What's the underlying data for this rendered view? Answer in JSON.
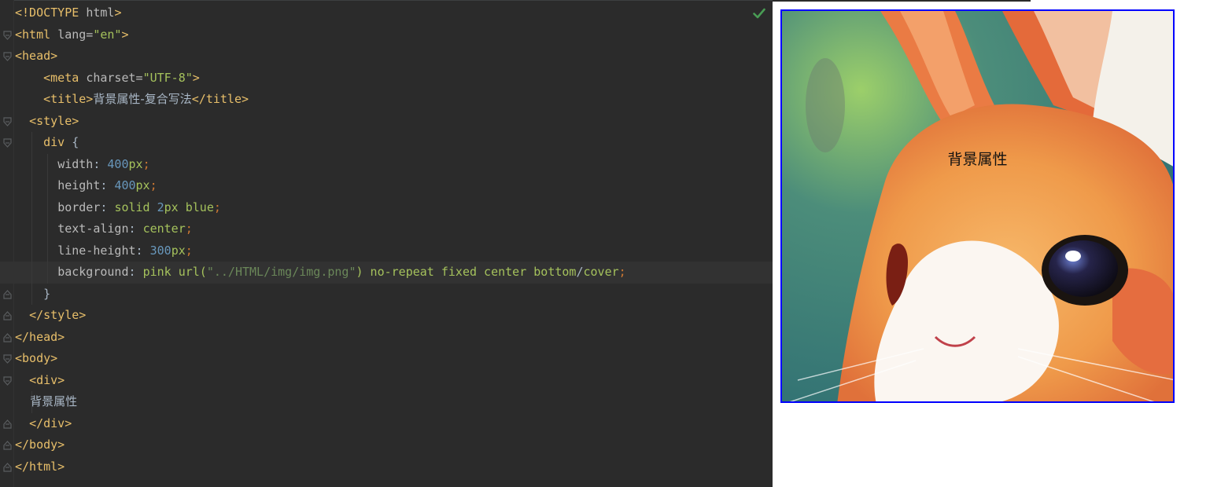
{
  "editor": {
    "lines": [
      {
        "parts": [
          {
            "c": "tag",
            "t": "<!DOCTYPE "
          },
          {
            "c": "attr",
            "t": "html"
          },
          {
            "c": "tag",
            "t": ">"
          }
        ]
      },
      {
        "parts": [
          {
            "c": "tag",
            "t": "<html "
          },
          {
            "c": "attr",
            "t": "lang="
          },
          {
            "c": "str",
            "t": "\"en\""
          },
          {
            "c": "tag",
            "t": ">"
          }
        ]
      },
      {
        "parts": [
          {
            "c": "tag",
            "t": "<head>"
          }
        ]
      },
      {
        "parts": [
          {
            "c": "plain",
            "t": "    "
          },
          {
            "c": "tag",
            "t": "<meta "
          },
          {
            "c": "attr",
            "t": "charset="
          },
          {
            "c": "str",
            "t": "\"UTF-8\""
          },
          {
            "c": "tag",
            "t": ">"
          }
        ]
      },
      {
        "parts": [
          {
            "c": "plain",
            "t": "    "
          },
          {
            "c": "tag",
            "t": "<title>"
          },
          {
            "c": "plain cn",
            "t": "背景属性-复合写法"
          },
          {
            "c": "tag",
            "t": "</title>"
          }
        ]
      },
      {
        "parts": [
          {
            "c": "plain",
            "t": "  "
          },
          {
            "c": "tag",
            "t": "<style>"
          }
        ]
      },
      {
        "parts": [
          {
            "c": "plain",
            "t": "    "
          },
          {
            "c": "sel",
            "t": "div "
          },
          {
            "c": "plain",
            "t": "{"
          }
        ]
      },
      {
        "parts": [
          {
            "c": "plain",
            "t": "      "
          },
          {
            "c": "prop",
            "t": "width"
          },
          {
            "c": "plain",
            "t": ": "
          },
          {
            "c": "num",
            "t": "400"
          },
          {
            "c": "val",
            "t": "px"
          },
          {
            "c": "punct",
            "t": ";"
          }
        ]
      },
      {
        "parts": [
          {
            "c": "plain",
            "t": "      "
          },
          {
            "c": "prop",
            "t": "height"
          },
          {
            "c": "plain",
            "t": ": "
          },
          {
            "c": "num",
            "t": "400"
          },
          {
            "c": "val",
            "t": "px"
          },
          {
            "c": "punct",
            "t": ";"
          }
        ]
      },
      {
        "parts": [
          {
            "c": "plain",
            "t": "      "
          },
          {
            "c": "prop",
            "t": "border"
          },
          {
            "c": "plain",
            "t": ": "
          },
          {
            "c": "val",
            "t": "solid "
          },
          {
            "c": "num",
            "t": "2"
          },
          {
            "c": "val",
            "t": "px blue"
          },
          {
            "c": "punct",
            "t": ";"
          }
        ]
      },
      {
        "parts": [
          {
            "c": "plain",
            "t": "      "
          },
          {
            "c": "prop",
            "t": "text-align"
          },
          {
            "c": "plain",
            "t": ": "
          },
          {
            "c": "val",
            "t": "center"
          },
          {
            "c": "punct",
            "t": ";"
          }
        ]
      },
      {
        "parts": [
          {
            "c": "plain",
            "t": "      "
          },
          {
            "c": "prop",
            "t": "line-height"
          },
          {
            "c": "plain",
            "t": ": "
          },
          {
            "c": "num",
            "t": "300"
          },
          {
            "c": "val",
            "t": "px"
          },
          {
            "c": "punct",
            "t": ";"
          }
        ]
      },
      {
        "parts": [
          {
            "c": "plain",
            "t": "      "
          },
          {
            "c": "prop",
            "t": "background"
          },
          {
            "c": "plain",
            "t": ": "
          },
          {
            "c": "val",
            "t": "pink url("
          },
          {
            "c": "urlstr",
            "t": "\"../HTML/img/img.png\""
          },
          {
            "c": "val",
            "t": ") no-repeat fixed center bottom"
          },
          {
            "c": "plain",
            "t": "/"
          },
          {
            "c": "val",
            "t": "cover"
          },
          {
            "c": "punct",
            "t": ";"
          }
        ]
      },
      {
        "parts": [
          {
            "c": "plain",
            "t": "    }"
          }
        ]
      },
      {
        "parts": [
          {
            "c": "plain",
            "t": "  "
          },
          {
            "c": "tag",
            "t": "</style>"
          }
        ]
      },
      {
        "parts": [
          {
            "c": "tag",
            "t": "</head>"
          }
        ]
      },
      {
        "parts": [
          {
            "c": "tag",
            "t": "<body>"
          }
        ]
      },
      {
        "parts": [
          {
            "c": "plain",
            "t": "  "
          },
          {
            "c": "tag",
            "t": "<div>"
          }
        ]
      },
      {
        "parts": [
          {
            "c": "plain cn",
            "t": "    背景属性"
          }
        ]
      },
      {
        "parts": [
          {
            "c": "plain",
            "t": "  "
          },
          {
            "c": "tag",
            "t": "</div>"
          }
        ]
      },
      {
        "parts": [
          {
            "c": "tag",
            "t": "</body>"
          }
        ]
      },
      {
        "parts": [
          {
            "c": "tag",
            "t": "</html>"
          }
        ]
      }
    ],
    "folds": {
      "1": "open",
      "2": "open",
      "5": "open",
      "6": "open",
      "13": "close",
      "14": "close",
      "15": "close",
      "16": "open",
      "17": "open",
      "19": "close",
      "20": "close",
      "21": "close"
    },
    "current_line": 12,
    "inspection_status_icon": "check-icon"
  },
  "preview": {
    "box_text": "背景属性",
    "border_color": "#0000ff",
    "background_image": "rabbit-illustration"
  }
}
